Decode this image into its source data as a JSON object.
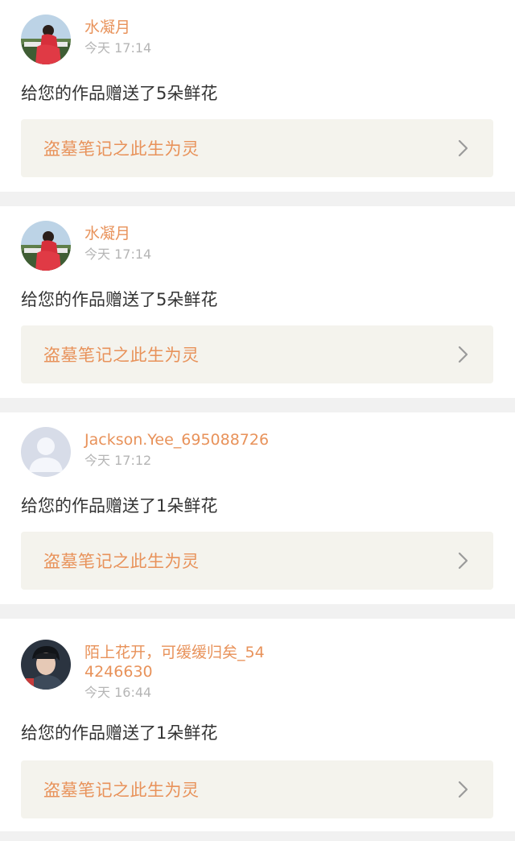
{
  "notifications": [
    {
      "user": {
        "name": "水凝月",
        "avatar": "photo-avatar-red-dress"
      },
      "time": "今天 17:14",
      "message": "给您的作品赠送了5朵鲜花",
      "work": {
        "title": "盗墓笔记之此生为灵"
      }
    },
    {
      "user": {
        "name": "水凝月",
        "avatar": "photo-avatar-red-dress"
      },
      "time": "今天 17:14",
      "message": "给您的作品赠送了5朵鲜花",
      "work": {
        "title": "盗墓笔记之此生为灵"
      }
    },
    {
      "user": {
        "name": "Jackson.Yee_695088726",
        "avatar": "default-avatar"
      },
      "time": "今天 17:12",
      "message": "给您的作品赠送了1朵鲜花",
      "work": {
        "title": "盗墓笔记之此生为灵"
      }
    },
    {
      "user": {
        "name": "陌上花开，可缓缓归矣_544246630",
        "avatar": "photo-avatar-dark-hair"
      },
      "time": "今天 16:44",
      "message": "给您的作品赠送了1朵鲜花",
      "work": {
        "title": "盗墓笔记之此生为灵"
      }
    }
  ],
  "colors": {
    "accent": "#e8925a",
    "text": "#333333",
    "muted": "#b5b5b5",
    "link_bg": "#f4f3ed",
    "divider": "#f1f1f1"
  }
}
